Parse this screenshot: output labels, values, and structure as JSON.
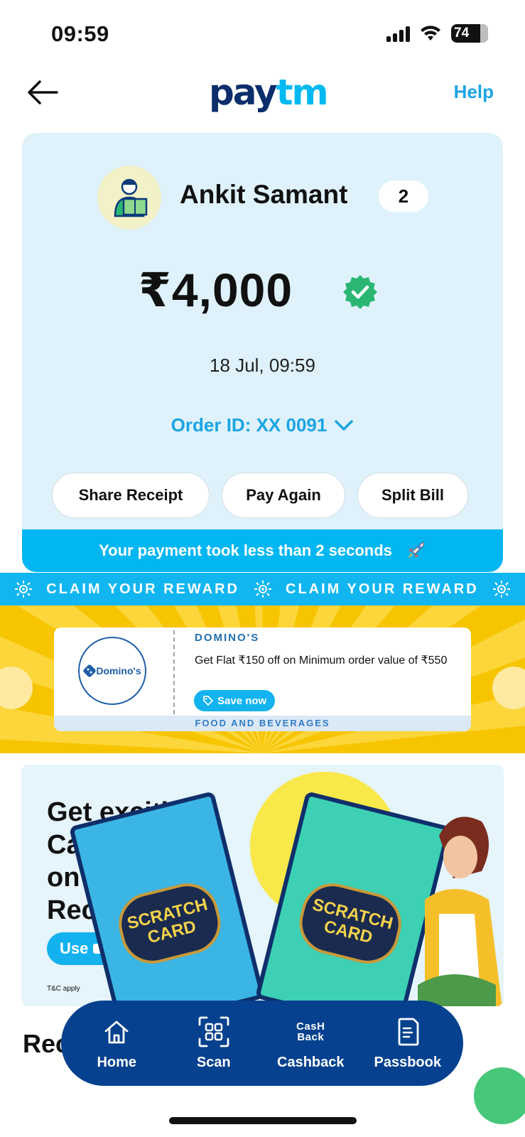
{
  "status_bar": {
    "time": "09:59",
    "battery": "74"
  },
  "header": {
    "logo_pay": "pay",
    "logo_tm": "tm",
    "help_label": "Help"
  },
  "receipt": {
    "payee_name": "Ankit Samant",
    "payment_count": "2",
    "amount": "₹4,000",
    "datetime": "18 Jul, 09:59",
    "order_id": "Order ID: XX 0091",
    "actions": [
      "Share Receipt",
      "Pay Again",
      "Split Bill"
    ],
    "speed_message": "Your payment took less than 2 seconds"
  },
  "reward": {
    "strip_text": "CLAIM YOUR REWARD",
    "coupon": {
      "logo_text": "Domino's",
      "brand": "DOMINO'S",
      "offer": "Get Flat ₹150 off on Minimum order value of ₹550",
      "cta": "Save now",
      "category": "FOOD AND BEVERAGES"
    }
  },
  "promo": {
    "title_lines": [
      "Get excitin",
      "Cash",
      "on",
      "Rec"
    ],
    "cta": "Use",
    "terms": "T&C apply",
    "card_label_1": "SCRATCH",
    "card_label_2": "CARD"
  },
  "recent_heading": "Rec",
  "bottom_nav": {
    "items": [
      {
        "label": "Home",
        "icon": "home-icon"
      },
      {
        "label": "Scan",
        "icon": "scan-icon"
      },
      {
        "label": "Cashback",
        "icon": "cashback-icon",
        "glyph_top": "CasH",
        "glyph_bottom": "Back"
      },
      {
        "label": "Passbook",
        "icon": "passbook-icon"
      }
    ]
  },
  "colors": {
    "brand_dark": "#0b2e6b",
    "brand_light": "#00b9f1",
    "nav_bg": "#05418f",
    "card_bg": "#dff2fb",
    "verified": "#2bb673"
  }
}
